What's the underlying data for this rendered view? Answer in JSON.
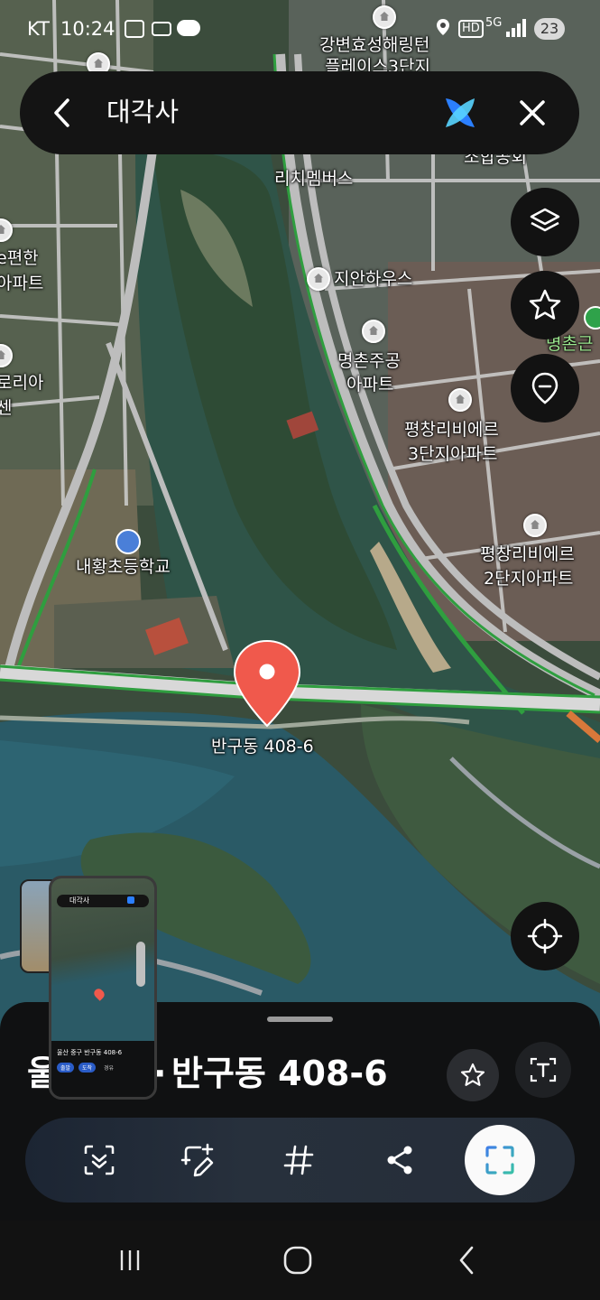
{
  "status_bar": {
    "carrier": "KT",
    "time": "10:24",
    "network": "5G",
    "hd": "HD",
    "battery": "23"
  },
  "search": {
    "query": "대각사"
  },
  "map": {
    "labels": {
      "gangbyeon": "강변효성해링턴",
      "place3": "플레이스3단지",
      "richmembers": "리치멤버스",
      "jianhouse": "지안하우스",
      "myeongchon_jugong_1": "명촌주공",
      "myeongchon_jugong_2": "아파트",
      "pyeongchang3_1": "평창리비에르",
      "pyeongchang3_2": "3단지아파트",
      "pyeongchang2_1": "평창리비에르",
      "pyeongchang2_2": "2단지아파트",
      "naehwang_school": "내황초등학교",
      "left_apt_1": "e편한",
      "left_apt_2": "아파트",
      "left_apt2_1": "로리아",
      "left_apt2_2": "센",
      "myeongchon_right": "명촌근",
      "joheop": "조합공회",
      "pin_label": "반구동 408-6"
    }
  },
  "thumbnail": {
    "search_text": "대각사",
    "address": "울산 중구 반구동 408-6",
    "chip1": "출발",
    "chip2": "도착",
    "chip3": "경유"
  },
  "sheet": {
    "title_prefix": "울",
    "title_mid": "·",
    "title": "반구동 408-6"
  },
  "colors": {
    "pin": "#f0594c",
    "road_green": "#2f9e3f",
    "river": "#2b5e68",
    "sheet_bg": "#101112"
  },
  "icons": {
    "back": "chevron-left-icon",
    "ai": "ai-logo-icon",
    "close": "close-icon",
    "layers": "layers-icon",
    "favorite": "star-icon",
    "place": "location-pin-icon",
    "my_location": "crosshair-icon",
    "scan": "scan-icon",
    "edit": "edit-icon",
    "hashtag": "hashtag-icon",
    "share": "share-icon",
    "capture": "capture-frame-icon",
    "text_recognize": "text-recognize-icon"
  }
}
